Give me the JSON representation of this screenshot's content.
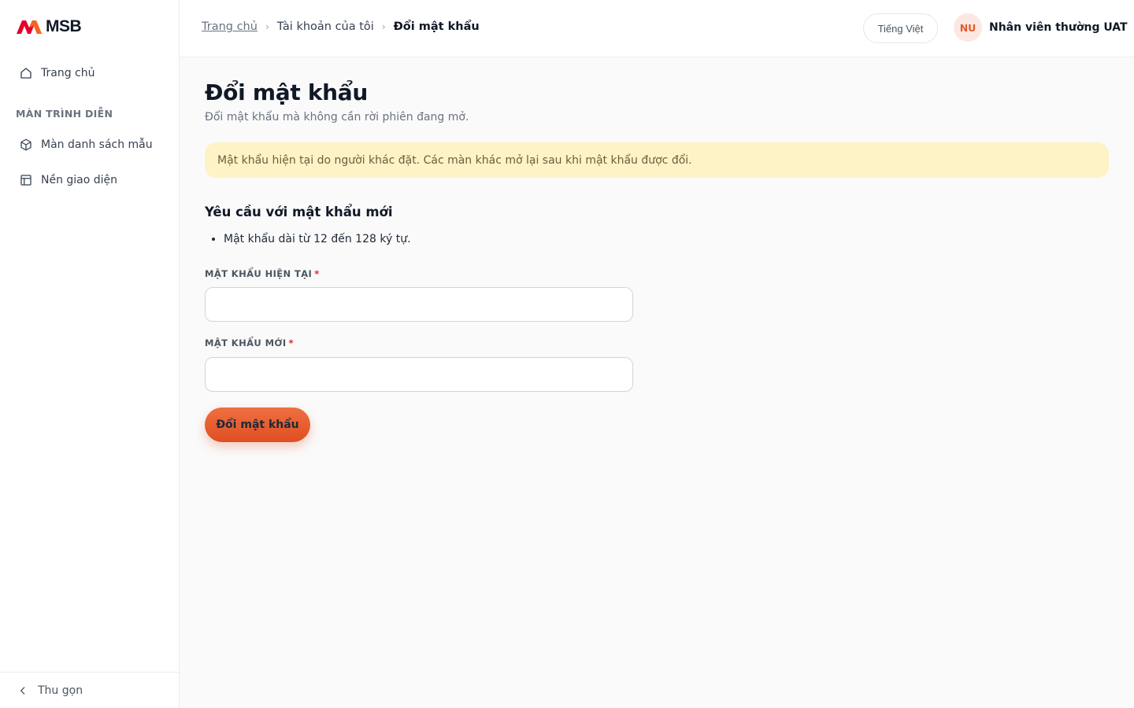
{
  "brand": {
    "name": "MSB",
    "logo_colors": [
      "#e4002b",
      "#f26522"
    ]
  },
  "sidebar": {
    "home_label": "Trang chủ",
    "section_title": "MÀN TRÌNH DIỄN",
    "items": [
      {
        "label": "Màn danh sách mẫu",
        "icon": "cube-icon"
      },
      {
        "label": "Nền giao diện",
        "icon": "layout-icon"
      }
    ],
    "collapse_label": "Thu gọn"
  },
  "header": {
    "breadcrumb": [
      "Trang chủ",
      "Tài khoản của tôi",
      "Đổi mật khẩu"
    ],
    "language": "Tiếng Việt",
    "user": {
      "initials": "NU",
      "name": "Nhân viên thường UAT"
    }
  },
  "page": {
    "title": "Đổi mật khẩu",
    "subtitle": "Đổi mật khẩu mà không cần rời phiên đang mở.",
    "alert": "Mật khẩu hiện tại do người khác đặt. Các màn khác mở lại sau khi mật khẩu được đổi.",
    "requirements_title": "Yêu cầu với mật khẩu mới",
    "requirements": [
      "Mật khẩu dài từ 12 đến 128 ký tự."
    ],
    "fields": {
      "current_password": {
        "label": "MẬT KHẨU HIỆN TẠI",
        "required_mark": "*",
        "value": ""
      },
      "new_password": {
        "label": "MẬT KHẨU MỚI",
        "required_mark": "*",
        "value": ""
      }
    },
    "submit_label": "Đổi mật khẩu"
  },
  "colors": {
    "accent": "#e85a2c",
    "alert_bg": "#fef3c7",
    "required": "#dc2626"
  }
}
